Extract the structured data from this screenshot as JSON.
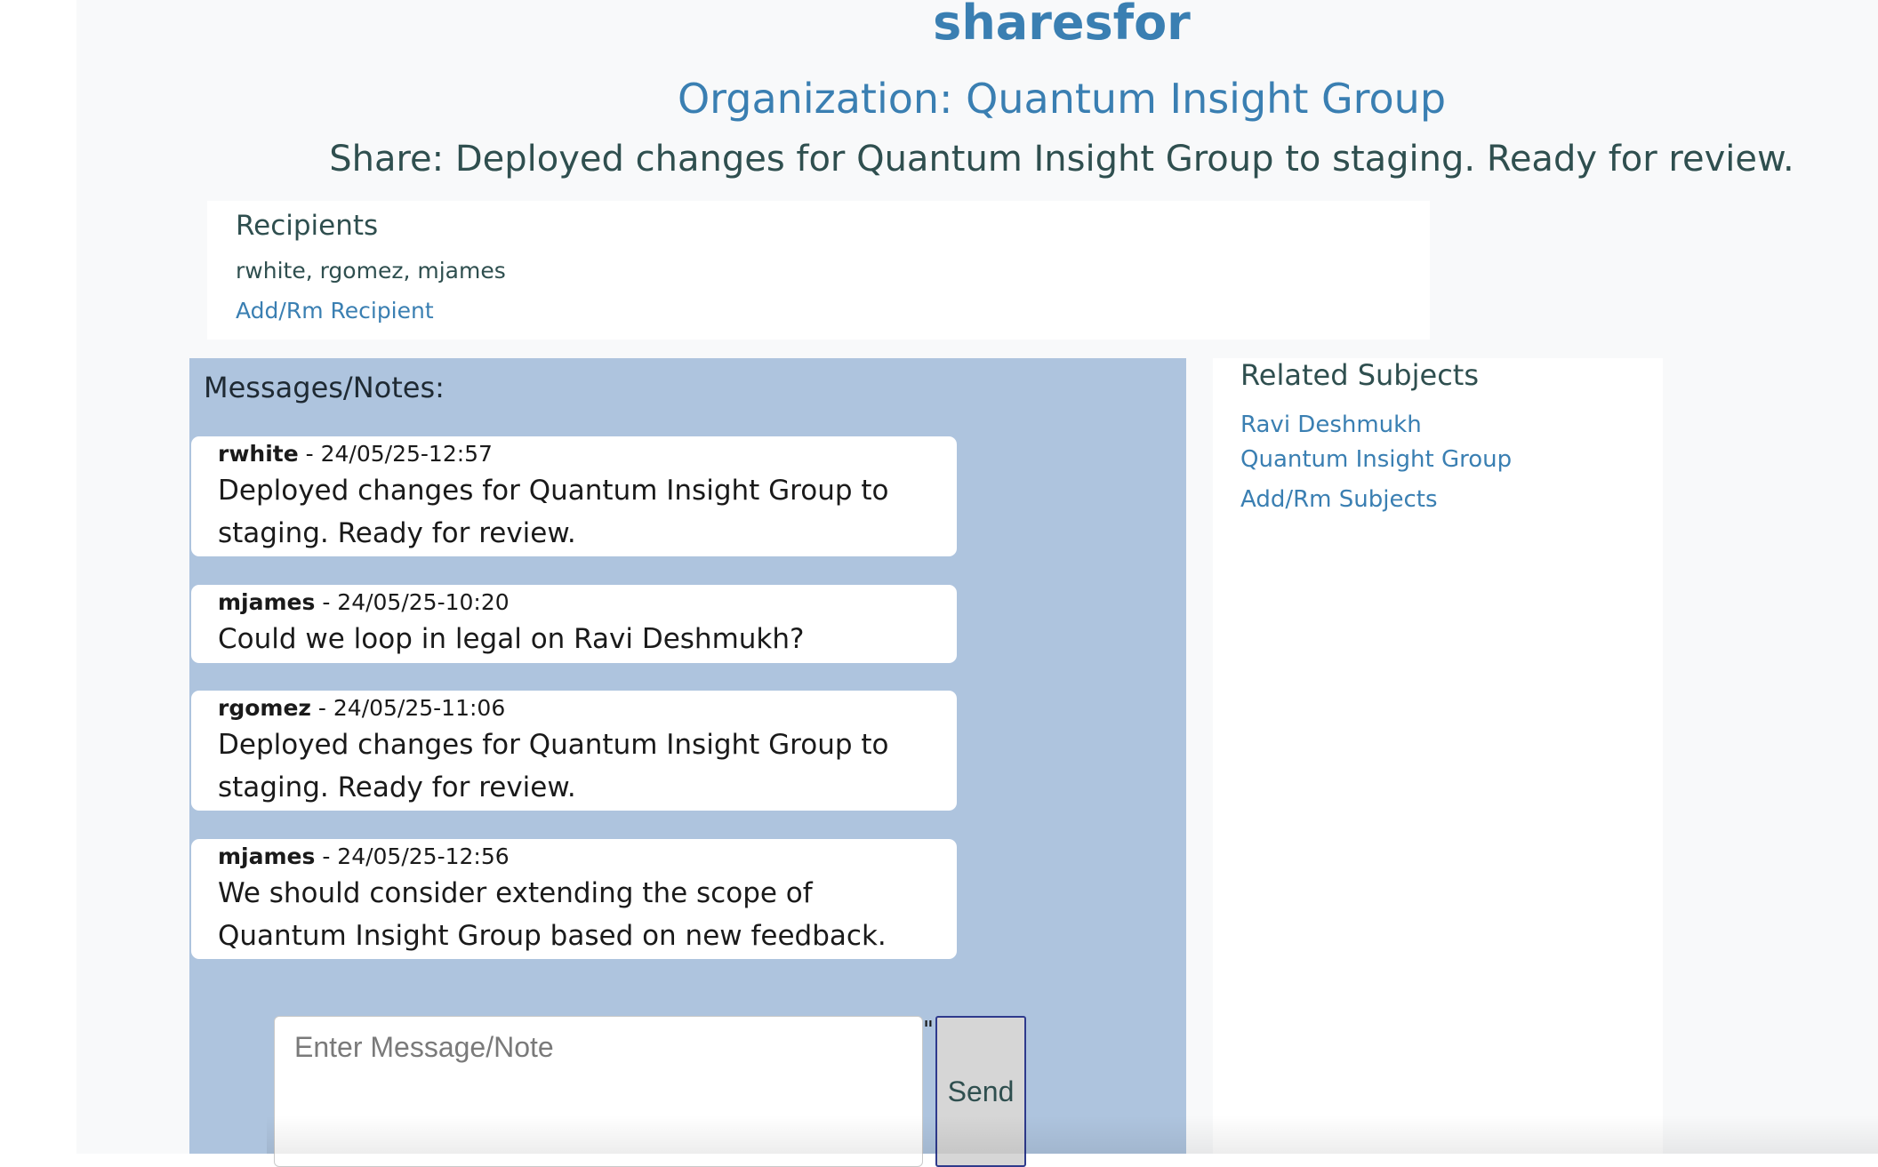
{
  "app": {
    "title": "sharesfor"
  },
  "header": {
    "organization": "Organization: Quantum Insight Group",
    "share": "Share: Deployed changes for Quantum Insight Group to staging. Ready for review."
  },
  "recipients": {
    "heading": "Recipients",
    "list": "rwhite, rgomez, mjames",
    "add_link": "Add/Rm Recipient"
  },
  "messages": {
    "heading": "Messages/Notes:",
    "items": [
      {
        "author": "rwhite",
        "timestamp": " - 24/05/25-12:57",
        "text": "Deployed changes for Quantum Insight Group to staging. Ready for review."
      },
      {
        "author": "mjames",
        "timestamp": " - 24/05/25-10:20",
        "text": "Could we loop in legal on Ravi Deshmukh?"
      },
      {
        "author": "rgomez",
        "timestamp": " - 24/05/25-11:06",
        "text": "Deployed changes for Quantum Insight Group to staging. Ready for review."
      },
      {
        "author": "mjames",
        "timestamp": " - 24/05/25-12:56",
        "text": "We should consider extending the scope of Quantum Insight Group based on new feedback."
      }
    ]
  },
  "composer": {
    "placeholder": "Enter Message/Note",
    "value": "",
    "stray_char": "\"",
    "send_label": "Send"
  },
  "subjects": {
    "heading": "Related Subjects",
    "items": [
      "Ravi Deshmukh",
      "Quantum Insight Group"
    ],
    "add_link": "Add/Rm Subjects"
  }
}
